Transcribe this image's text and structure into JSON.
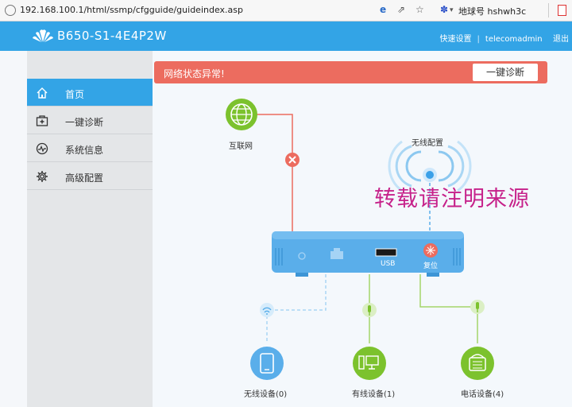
{
  "browser": {
    "url": "192.168.100.1/html/ssmp/cfgguide/guideindex.asp",
    "search_text": "地球号 hshwh3c"
  },
  "header": {
    "model": "B650-S1-4E4P2W",
    "quick_setup": "快速设置",
    "user": "telecomadmin",
    "logout": "退出"
  },
  "sidebar": {
    "items": [
      {
        "label": "首页",
        "icon": "home-icon",
        "active": true
      },
      {
        "label": "一键诊断",
        "icon": "diagnose-icon",
        "active": false
      },
      {
        "label": "系统信息",
        "icon": "system-info-icon",
        "active": false
      },
      {
        "label": "高级配置",
        "icon": "gear-icon",
        "active": false
      }
    ]
  },
  "alert": {
    "message": "网络状态异常!",
    "button": "一键诊断"
  },
  "diagram": {
    "internet": "互联网",
    "wireless_config": "无线配置",
    "usb": "USB",
    "reset": "复位",
    "wireless_devices": "无线设备(0)",
    "wired_devices": "有线设备(1)",
    "phone_devices": "电话设备(4)"
  },
  "watermark": "转载请注明来源",
  "colors": {
    "header_blue": "#33a4e6",
    "alert_red": "#ec6c5f",
    "green": "#7cc22d",
    "error_red": "#ec6c5f",
    "router_blue": "#5aaeea"
  }
}
